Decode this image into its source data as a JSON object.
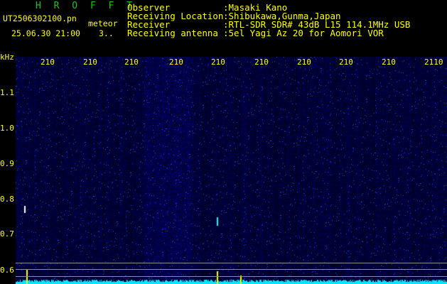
{
  "header": {
    "app_title": "H R O F F T",
    "file_name": "UT2506302100.pn",
    "tag": "meteor",
    "date_time": "25.06.30 21:00",
    "count": "3..",
    "info": [
      {
        "label": "Observer",
        "value": ":Masaki Kano"
      },
      {
        "label": "Receiving Location",
        "value": ":Shibukawa,Gunma,Japan"
      },
      {
        "label": "Receiver",
        "value": ":RTL-SDR SDR# 43dB L15 114.1MHz USB"
      },
      {
        "label": "Receiving antenna",
        "value": ":5el Yagi Az 20 for Aomori VOR"
      }
    ]
  },
  "axis": {
    "y_unit": "kHz",
    "y_ticks": [
      "1.1",
      "1.0",
      "0.9",
      "0.8",
      "0.7",
      "0.6"
    ],
    "x_ticks": [
      "210",
      "210",
      "210",
      "210",
      "210",
      "210",
      "210",
      "210",
      "210",
      "2110"
    ]
  },
  "colors": {
    "label_yellow": "#ffff00",
    "title_green": "#19c519",
    "noise_cyan": "#00e5ff",
    "background": "#000000"
  }
}
